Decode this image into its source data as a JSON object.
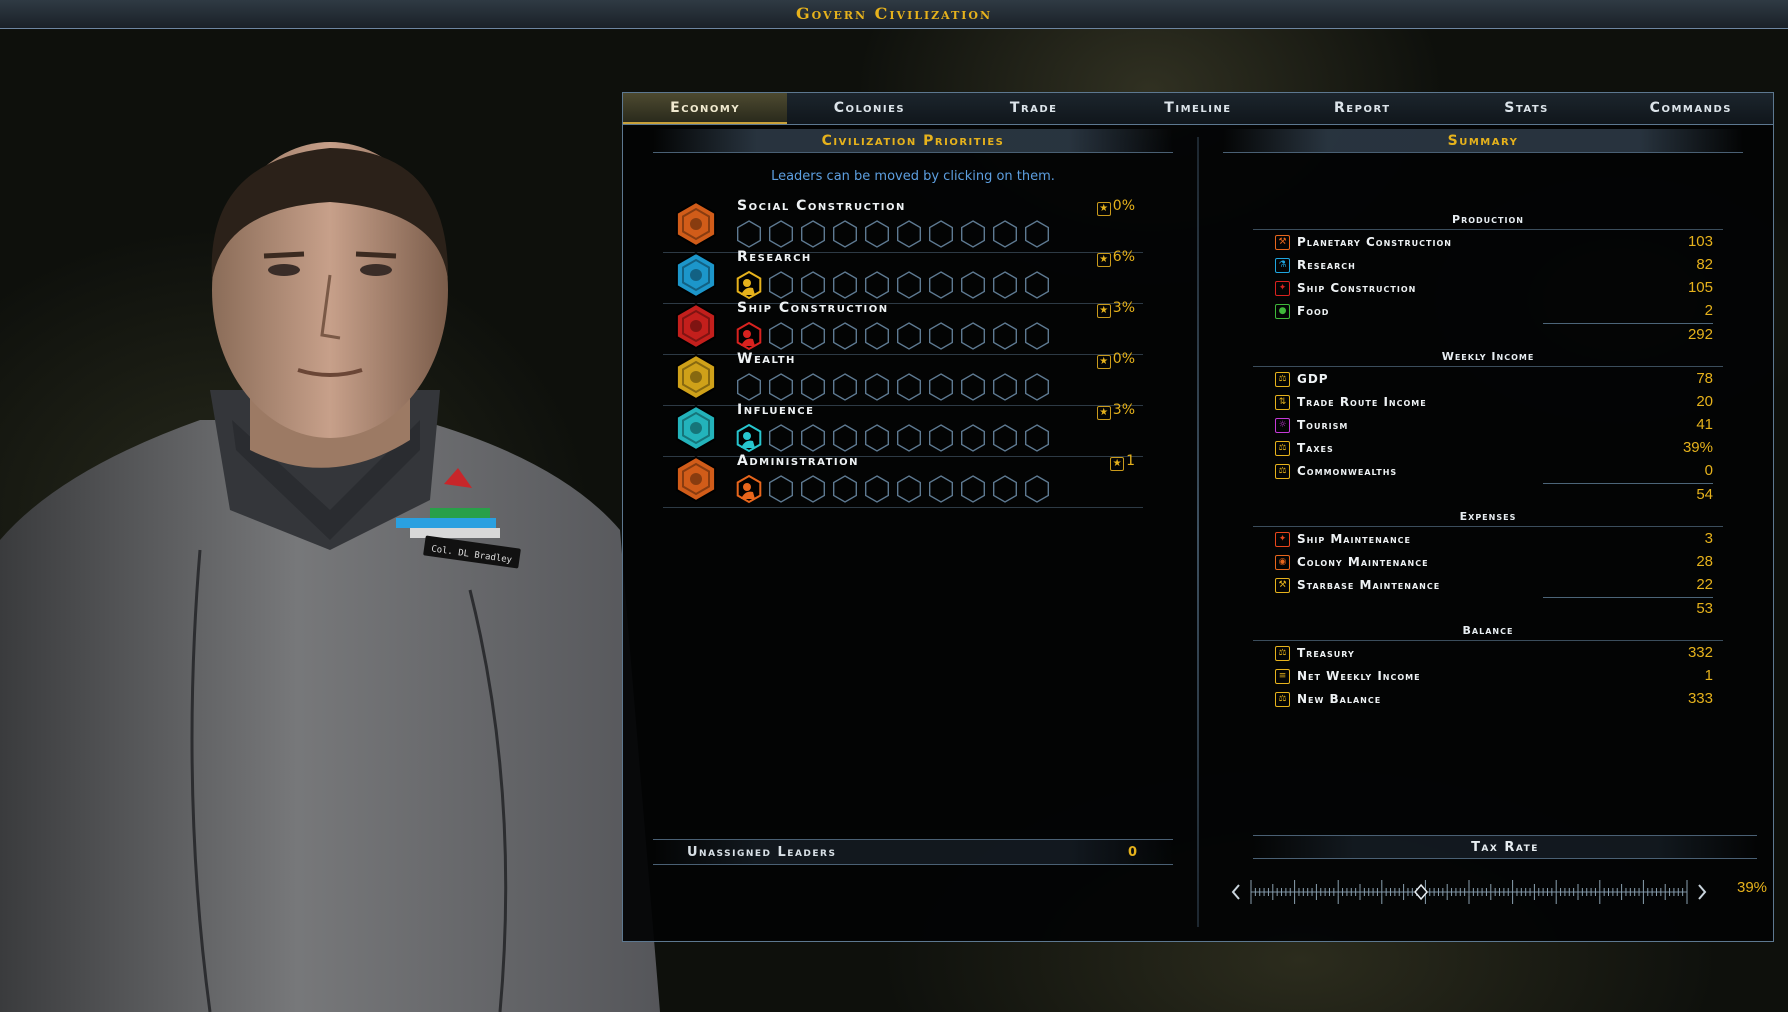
{
  "window": {
    "title": "Govern Civilization"
  },
  "tabs": [
    {
      "label": "Economy",
      "active": true
    },
    {
      "label": "Colonies"
    },
    {
      "label": "Trade"
    },
    {
      "label": "Timeline"
    },
    {
      "label": "Report"
    },
    {
      "label": "Stats"
    },
    {
      "label": "Commands"
    }
  ],
  "priorities": {
    "title": "Civilization Priorities",
    "hint": "Leaders can be moved by clicking on them.",
    "items": [
      {
        "label": "Social Construction",
        "pct": "0%",
        "icon": "hammer-icon",
        "color": "#e8661c",
        "assigned": false
      },
      {
        "label": "Research",
        "pct": "6%",
        "icon": "flask-icon",
        "color": "#1fa6e0",
        "assigned": true,
        "assigned_color": "#e6b21c"
      },
      {
        "label": "Ship Construction",
        "pct": "3%",
        "icon": "ship-icon",
        "color": "#d8221f",
        "assigned": true,
        "assigned_color": "#d8221f"
      },
      {
        "label": "Wealth",
        "pct": "0%",
        "icon": "coins-icon",
        "color": "#e6b21c",
        "assigned": false
      },
      {
        "label": "Influence",
        "pct": "3%",
        "icon": "flag-icon",
        "color": "#27c6cf",
        "assigned": true,
        "assigned_color": "#27c6cf"
      },
      {
        "label": "Administration",
        "pct": "1",
        "icon": "gear-icon",
        "color": "#e8661c",
        "assigned": true,
        "assigned_color": "#e8661c"
      }
    ],
    "unassigned_label": "Unassigned Leaders",
    "unassigned_value": "0"
  },
  "summary": {
    "title": "Summary",
    "production": {
      "title": "Production",
      "rows": [
        {
          "label": "Planetary Construction",
          "value": "103",
          "icon": "hammer-icon",
          "color": "#e8661c"
        },
        {
          "label": "Research",
          "value": "82",
          "icon": "flask-icon",
          "color": "#1fa6e0"
        },
        {
          "label": "Ship Construction",
          "value": "105",
          "icon": "ship-icon",
          "color": "#d8221f"
        },
        {
          "label": "Food",
          "value": "2",
          "icon": "apple-icon",
          "color": "#3fb83a"
        }
      ],
      "total": "292"
    },
    "income": {
      "title": "Weekly Income",
      "rows": [
        {
          "label": "GDP",
          "value": "78",
          "icon": "scale-icon",
          "color": "#e6b21c"
        },
        {
          "label": "Trade Route Income",
          "value": "20",
          "icon": "trade-icon",
          "color": "#e6b21c"
        },
        {
          "label": "Tourism",
          "value": "41",
          "icon": "tourism-icon",
          "color": "#c53ad8"
        },
        {
          "label": "Taxes",
          "value": "39%",
          "icon": "scale-icon",
          "color": "#e6b21c"
        },
        {
          "label": "Commonwealths",
          "value": "0",
          "icon": "scale-icon",
          "color": "#e6b21c"
        }
      ],
      "total": "54"
    },
    "expenses": {
      "title": "Expenses",
      "rows": [
        {
          "label": "Ship Maintenance",
          "value": "3",
          "icon": "ship-maint-icon",
          "color": "#e8461c"
        },
        {
          "label": "Colony Maintenance",
          "value": "28",
          "icon": "colony-maint-icon",
          "color": "#e8661c"
        },
        {
          "label": "Starbase Maintenance",
          "value": "22",
          "icon": "starbase-maint-icon",
          "color": "#e6b21c"
        }
      ],
      "total": "53"
    },
    "balance": {
      "title": "Balance",
      "rows": [
        {
          "label": "Treasury",
          "value": "332",
          "icon": "scale-icon",
          "color": "#e6b21c"
        },
        {
          "label": "Net Weekly Income",
          "value": "1",
          "icon": "ledger-icon",
          "color": "#e6b21c"
        },
        {
          "label": "New Balance",
          "value": "333",
          "icon": "scale-icon",
          "color": "#e6b21c"
        }
      ]
    }
  },
  "tax": {
    "title": "Tax Rate",
    "value": "39%",
    "fraction": 0.39
  },
  "portrait": {
    "nametag": "Col. DL Bradley"
  }
}
